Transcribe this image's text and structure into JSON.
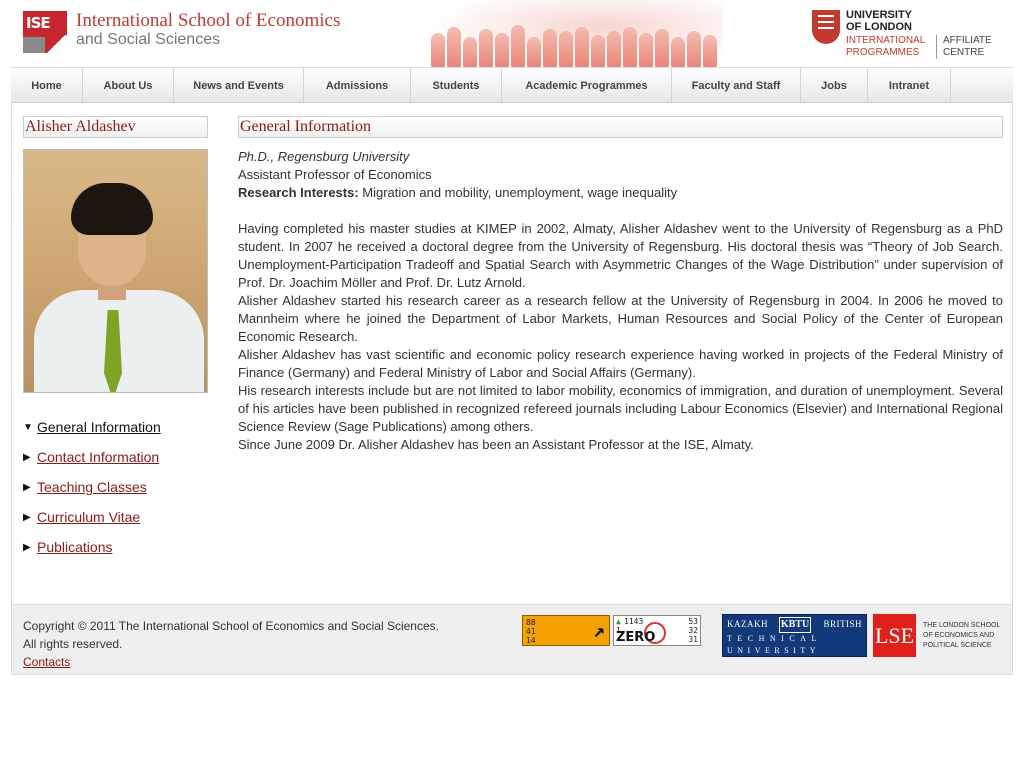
{
  "header": {
    "logo_text": "ISE",
    "school_name_line1": "International School of Economics",
    "school_name_line2": "and Social Sciences",
    "uol_line1": "UNIVERSITY OF LONDON",
    "uol_line2": "INTERNATIONAL PROGRAMMES",
    "uol_line3": "AFFILIATE CENTRE"
  },
  "nav": {
    "items": [
      {
        "label": "Home"
      },
      {
        "label": "About Us"
      },
      {
        "label": "News and Events"
      },
      {
        "label": "Admissions"
      },
      {
        "label": "Students"
      },
      {
        "label": "Academic Programmes"
      },
      {
        "label": "Faculty and Staff"
      },
      {
        "label": "Jobs"
      },
      {
        "label": "Intranet"
      }
    ]
  },
  "sidebar": {
    "person_name": "Alisher Aldashev",
    "links": [
      {
        "label": "General Information",
        "active": true
      },
      {
        "label": "Contact Information",
        "active": false
      },
      {
        "label": "Teaching Classes",
        "active": false
      },
      {
        "label": "Curriculum Vitae",
        "active": false
      },
      {
        "label": "Publications",
        "active": false
      }
    ]
  },
  "main": {
    "section_title": "General Information",
    "degree": "Ph.D., Regensburg University",
    "position": "Assistant Professor of Economics",
    "research_label": "Research Interests:",
    "research_value": " Migration and mobility, unemployment, wage inequality",
    "paragraphs": [
      "Having completed his master studies at KIMEP in 2002, Almaty, Alisher Aldashev went to the University of Regensburg as a PhD student. In 2007 he received a doctoral degree from the University of Regensburg. His doctoral thesis was “Theory of Job Search. Unemployment-Participation Tradeoff and Spatial Search with Asymmetric Changes of the Wage Distribution” under supervision of Prof. Dr. Joachim Möller and Prof. Dr. Lutz Arnold.",
      "Alisher Aldashev started his research career as a research fellow at the University of Regensburg in 2004. In 2006 he moved to Mannheim where he joined the Department of Labor Markets, Human Resources and Social Policy of the Center of European Economic Research.",
      "Alisher Aldashev has vast scientific and economic policy research experience having worked in projects of the Federal Ministry of Finance (Germany) and Federal Ministry of Labor and Social Affairs (Germany).",
      "His research interests include but are not limited to labor mobility, economics of immigration, and duration of unemployment. Several of his articles have been published in recognized refereed journals including Labour Economics (Elsevier) and International Regional Science Review (Sage Publications) among others.",
      "Since June 2009 Dr. Alisher Aldashev has been an Assistant Professor at the ISE, Almaty."
    ]
  },
  "footer": {
    "copyright": "Copyright © 2011 The International School of Economics and Social Sciences.",
    "rights": "All rights reserved.",
    "contacts": "Contacts",
    "counter1": {
      "v1": "88",
      "v2": "41",
      "v3": "14"
    },
    "counter2": {
      "top": "1143",
      "mid": "1",
      "zero": "ZERO",
      "r1": "53",
      "r2": "32",
      "r3": "31"
    },
    "kbtu": {
      "left": "KAZAKH",
      "box": "KBTU",
      "right": "BRITISH",
      "mid": "TECHNICAL",
      "bottom": "UNIVERSITY"
    },
    "lse": {
      "box": "LSE",
      "text": "THE LONDON SCHOOL OF ECONOMICS AND POLITICAL SCIENCE"
    }
  }
}
